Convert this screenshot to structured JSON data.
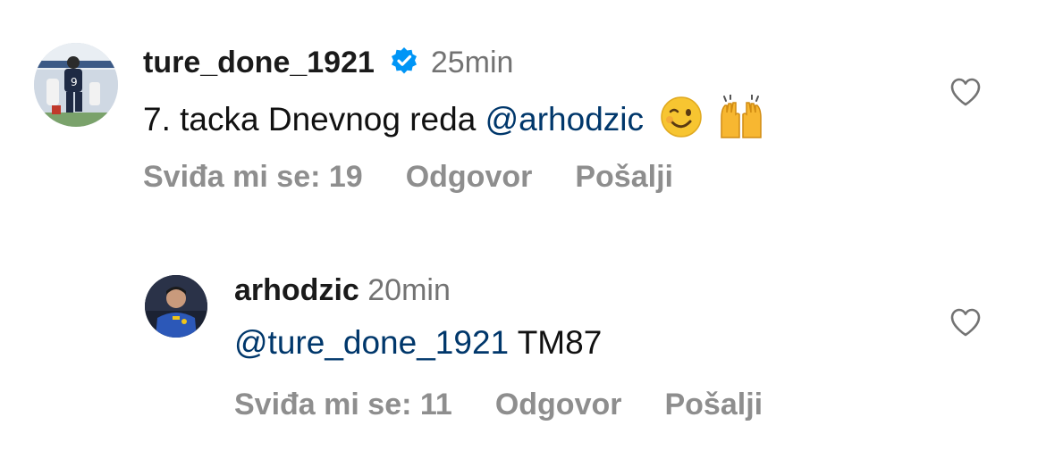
{
  "comments": [
    {
      "username": "ture_done_1921",
      "verified": true,
      "time": "25min",
      "text_prefix": "7. tacka Dnevnog reda ",
      "mention": "@arhodzic",
      "text_suffix": "",
      "emojis": [
        "winking-face",
        "raising-hands"
      ],
      "likes_label": "Sviđa mi se: 19",
      "reply_label": "Odgovor",
      "send_label": "Pošalji"
    },
    {
      "username": "arhodzic",
      "verified": false,
      "time": "20min",
      "text_prefix": "",
      "mention": "@ture_done_1921",
      "text_suffix": " TM87",
      "emojis": [],
      "likes_label": "Sviđa mi se: 11",
      "reply_label": "Odgovor",
      "send_label": "Pošalji"
    }
  ],
  "colors": {
    "mention": "#00376b",
    "muted": "#8e8e8e",
    "time": "#737373",
    "verified": "#0095f6"
  }
}
